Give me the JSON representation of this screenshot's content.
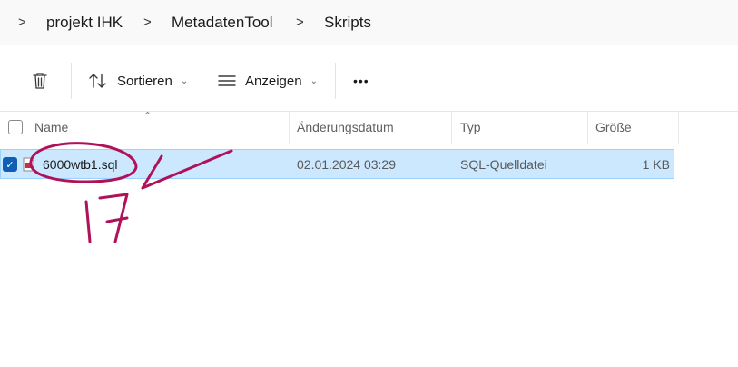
{
  "breadcrumb": {
    "items": [
      "projekt IHK",
      "MetadatenTool",
      "Skripts"
    ]
  },
  "toolbar": {
    "sort_label": "Sortieren",
    "view_label": "Anzeigen",
    "more_label": "•••"
  },
  "columns": {
    "name": "Name",
    "modified": "Änderungsdatum",
    "type": "Typ",
    "size": "Größe"
  },
  "files": [
    {
      "name": "6000wtb1.sql",
      "modified": "02.01.2024 03:29",
      "type": "SQL-Quelldatei",
      "size": "1 KB",
      "selected": true
    }
  ],
  "annotation": {
    "handwritten_text": "17",
    "color": "#b0125a"
  },
  "colors": {
    "selection_bg": "#cce8ff",
    "selection_border": "#99d1ff",
    "checkbox_accent": "#0f5fb7"
  }
}
